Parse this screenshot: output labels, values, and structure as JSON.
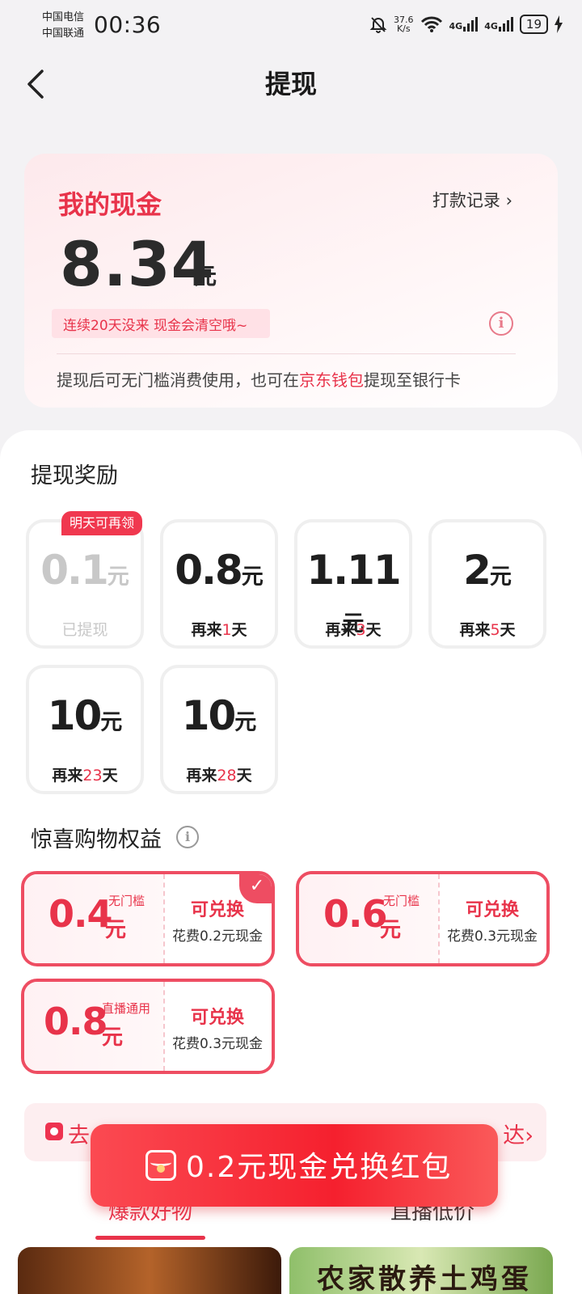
{
  "status_bar": {
    "carrier1": "中国电信",
    "carrier2": "中国联通",
    "time": "00:36",
    "net_speed_value": "37.6",
    "net_speed_unit": "K/s",
    "sig1": "4G",
    "sig2": "4G",
    "battery": "19"
  },
  "header": {
    "title": "提现"
  },
  "cash": {
    "label": "我的现金",
    "records_link": "打款记录",
    "amount": "8.34",
    "unit": "元",
    "warning": "连续20天没来 现金会清空哦~",
    "note_prefix": "提现后可无门槛消费使用，也可在",
    "note_highlight": "京东钱包",
    "note_suffix": "提现至银行卡"
  },
  "rewards": {
    "title": "提现奖励",
    "ribbon": "明天可再领",
    "tiles": [
      {
        "value": "0.1",
        "unit": "元",
        "status": "已提现"
      },
      {
        "value": "0.8",
        "unit": "元",
        "pre": "再来",
        "days": "1",
        "post": "天"
      },
      {
        "value": "1.11",
        "unit": "元",
        "pre": "再来",
        "days": "3",
        "post": "天"
      },
      {
        "value": "2",
        "unit": "元",
        "pre": "再来",
        "days": "5",
        "post": "天"
      },
      {
        "value": "10",
        "unit": "元",
        "pre": "再来",
        "days": "23",
        "post": "天"
      },
      {
        "value": "10",
        "unit": "元",
        "pre": "再来",
        "days": "28",
        "post": "天"
      }
    ]
  },
  "perks": {
    "title": "惊喜购物权益",
    "coupons": [
      {
        "value": "0.4",
        "unit": "元",
        "tag": "无门槛",
        "action": "可兑换",
        "cost": "花费0.2元现金",
        "selected": true
      },
      {
        "value": "0.6",
        "unit": "元",
        "tag": "无门槛",
        "action": "可兑换",
        "cost": "花费0.3元现金",
        "selected": false
      },
      {
        "value": "0.8",
        "unit": "元",
        "tag": "直播通用",
        "action": "可兑换",
        "cost": "花费0.3元现金",
        "selected": false
      }
    ]
  },
  "live_bar": {
    "start": "去",
    "end": "达"
  },
  "tabs": {
    "left": "爆款好物",
    "right": "直播低价"
  },
  "thumb_text": "农家散养土鸡蛋",
  "cta": {
    "label": "0.2元现金兑换红包"
  },
  "colors": {
    "accent": "#e8334a",
    "cta": "#f5202e"
  },
  "icons": [
    "back-arrow-icon",
    "info-icon",
    "check-icon",
    "red-packet-icon",
    "live-icon",
    "wifi-icon",
    "mute-bell-icon",
    "charging-icon"
  ]
}
